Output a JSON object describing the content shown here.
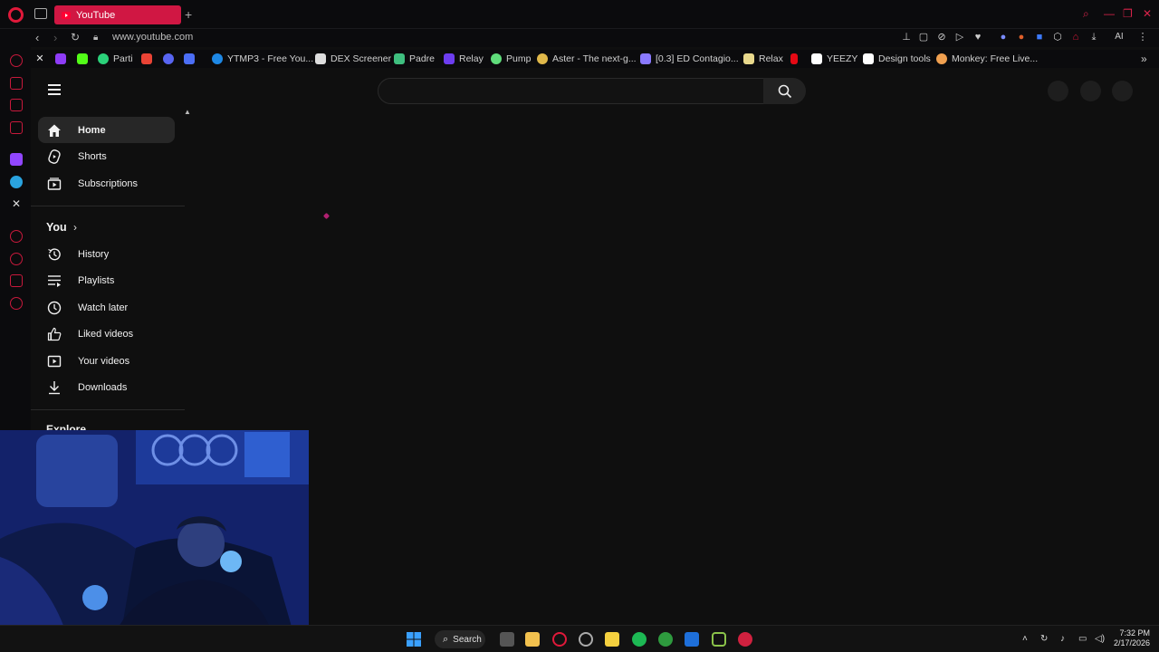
{
  "browser": {
    "active_tab_title": "YouTube",
    "url": "www.youtube.com",
    "toolbar_ai_label": "AI"
  },
  "bookmarks": [
    {
      "label": "",
      "icon": "x-icon",
      "color": "#e8e8e8"
    },
    {
      "label": "",
      "icon": "purple-app-icon",
      "color": "#8e3cf7"
    },
    {
      "label": "",
      "icon": "kick-icon",
      "color": "#53fc18"
    },
    {
      "label": "Parti",
      "icon": "parti-icon",
      "color": "#2bd17a"
    },
    {
      "label": "",
      "icon": "gmail-icon",
      "color": "#ea4335"
    },
    {
      "label": "",
      "icon": "discord-icon",
      "color": "#5865f2"
    },
    {
      "label": "",
      "icon": "blue-app-icon",
      "color": "#4c6ef5"
    },
    {
      "label": "YTMP3 - Free You...",
      "icon": "ytmp3-icon",
      "color": "#1e88e5"
    },
    {
      "label": "DEX Screener",
      "icon": "dex-icon",
      "color": "#dddddd"
    },
    {
      "label": "Padre",
      "icon": "padre-icon",
      "color": "#3fbf7f"
    },
    {
      "label": "Relay",
      "icon": "relay-icon",
      "color": "#6d3df0"
    },
    {
      "label": "Pump",
      "icon": "pump-icon",
      "color": "#5fdc7a"
    },
    {
      "label": "Aster - The next-g...",
      "icon": "aster-icon",
      "color": "#e0b84a"
    },
    {
      "label": "[0.3] ED Contagio...",
      "icon": "ed-icon",
      "color": "#8a79ff"
    },
    {
      "label": "Relax",
      "icon": "relax-icon",
      "color": "#e8d88c"
    },
    {
      "label": "",
      "icon": "netflix-icon",
      "color": "#e50914"
    },
    {
      "label": "YEEZY",
      "icon": "yeezy-icon",
      "color": "#ffffff"
    },
    {
      "label": "Design tools",
      "icon": "design-tools-icon",
      "color": "#ffffff"
    },
    {
      "label": "Monkey: Free Live...",
      "icon": "monkey-icon",
      "color": "#f0a050"
    }
  ],
  "youtube": {
    "search_placeholder": "",
    "sidebar": {
      "main": [
        {
          "label": "Home",
          "icon": "home-icon",
          "active": true
        },
        {
          "label": "Shorts",
          "icon": "shorts-icon",
          "active": false
        },
        {
          "label": "Subscriptions",
          "icon": "subscriptions-icon",
          "active": false
        }
      ],
      "you_heading": "You",
      "you_items": [
        {
          "label": "History",
          "icon": "history-icon"
        },
        {
          "label": "Playlists",
          "icon": "playlists-icon"
        },
        {
          "label": "Watch later",
          "icon": "watch-later-icon"
        },
        {
          "label": "Liked videos",
          "icon": "liked-videos-icon"
        },
        {
          "label": "Your videos",
          "icon": "your-videos-icon"
        },
        {
          "label": "Downloads",
          "icon": "downloads-icon"
        }
      ],
      "explore_heading": "Explore"
    }
  },
  "taskbar": {
    "search_label": "Search",
    "time": "7:32 PM",
    "date": "2/17/2026"
  },
  "colors": {
    "accent": "#d01743",
    "background": "#0f0f0f"
  }
}
